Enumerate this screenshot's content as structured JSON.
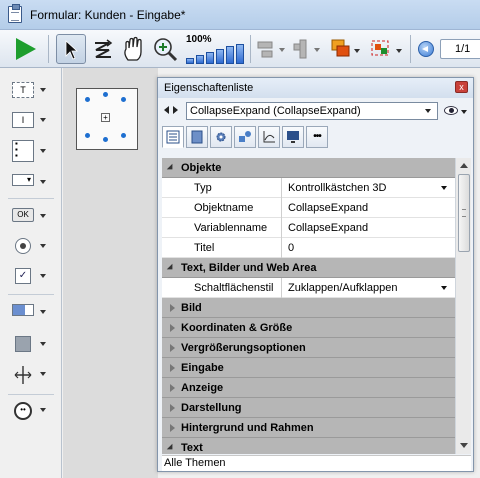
{
  "window": {
    "title": "Formular: Kunden -  Eingabe*"
  },
  "toolbar": {
    "zoom_label": "100%",
    "page_label": "1/1"
  },
  "canvas": {
    "object_center_glyph": "+"
  },
  "property_list": {
    "title": "Eigenschaftenliste",
    "close_glyph": "x",
    "object_selector": "CollapseExpand (CollapseExpand)",
    "tab_more": "•••",
    "sections": [
      {
        "label": "Objekte",
        "expanded": true
      },
      {
        "label": "Text, Bilder und Web Area",
        "expanded": true
      },
      {
        "label": "Bild",
        "expanded": false
      },
      {
        "label": "Koordinaten & Größe",
        "expanded": false
      },
      {
        "label": "Vergrößerungsoptionen",
        "expanded": false
      },
      {
        "label": "Eingabe",
        "expanded": false
      },
      {
        "label": "Anzeige",
        "expanded": false
      },
      {
        "label": "Darstellung",
        "expanded": false
      },
      {
        "label": "Hintergrund und Rahmen",
        "expanded": false
      },
      {
        "label": "Text",
        "expanded": true
      }
    ],
    "properties": [
      {
        "name": "Typ",
        "value": "Kontrollkästchen 3D"
      },
      {
        "name": "Objektname",
        "value": "CollapseExpand"
      },
      {
        "name": "Variablenname",
        "value": "CollapseExpand"
      },
      {
        "name": "Titel",
        "value": "0"
      },
      {
        "name": "Schaltflächenstil",
        "value": "Zuklappen/Aufklappen"
      }
    ],
    "theme_filter": "Alle Themen"
  },
  "palette": {
    "text_icon": "T",
    "ok_icon": "OK"
  },
  "colors": {
    "section_bg": "#b6b6b6",
    "accent_blue": "#2e6ad1",
    "play_green": "#1e9e2e",
    "close_red": "#c9413a"
  }
}
